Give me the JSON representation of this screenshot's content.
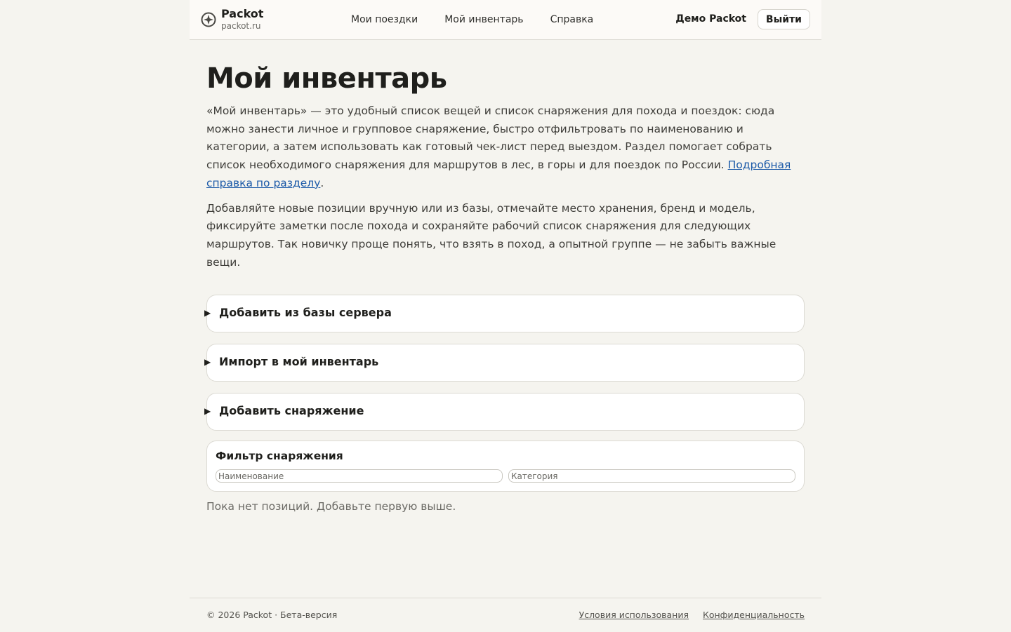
{
  "header": {
    "brand_name": "Packot",
    "brand_domain": "packot.ru",
    "brand_icon": "compass-icon",
    "nav": [
      {
        "label": "Мои поездки"
      },
      {
        "label": "Мой инвентарь"
      },
      {
        "label": "Справка"
      }
    ],
    "user_name": "Демо Packot",
    "logout_label": "Выйти"
  },
  "main": {
    "title": "Мой инвентарь",
    "intro_text": "«Мой инвентарь» — это удобный список вещей и список снаряжения для похода и поездок: сюда можно занести личное и групповое снаряжение, быстро отфильтровать по наименованию и категории, а затем использовать как готовый чек-лист перед выездом. Раздел помогает собрать список необходимого снаряжения для маршрутов в лес, в горы и для поездок по России.",
    "intro_link": "Подробная справка по разделу",
    "intro_end": ".",
    "second_text": "Добавляйте новые позиции вручную или из базы, отмечайте место хранения, бренд и модель, фиксируйте заметки после похода и сохраняйте рабочий список снаряжения для следующих маршрутов. Так новичку проще понять, что взять в поход, а опытной группе — не забыть важные вещи.",
    "panels": [
      {
        "title": "Добавить из базы сервера"
      },
      {
        "title": "Импорт в мой инвентарь"
      },
      {
        "title": "Добавить снаряжение"
      }
    ],
    "filter": {
      "title": "Фильтр снаряжения",
      "name_placeholder": "Наименование",
      "category_placeholder": "Категория"
    },
    "empty_text": "Пока нет позиций. Добавьте первую выше."
  },
  "footer": {
    "copyright": "© 2026 Packot · Бета-версия",
    "links": [
      {
        "label": "Условия использования"
      },
      {
        "label": "Конфиденциальность"
      }
    ]
  },
  "colors": {
    "background": "#f5f4ef",
    "link": "#1c5aa8",
    "text": "#1f1f1c"
  }
}
